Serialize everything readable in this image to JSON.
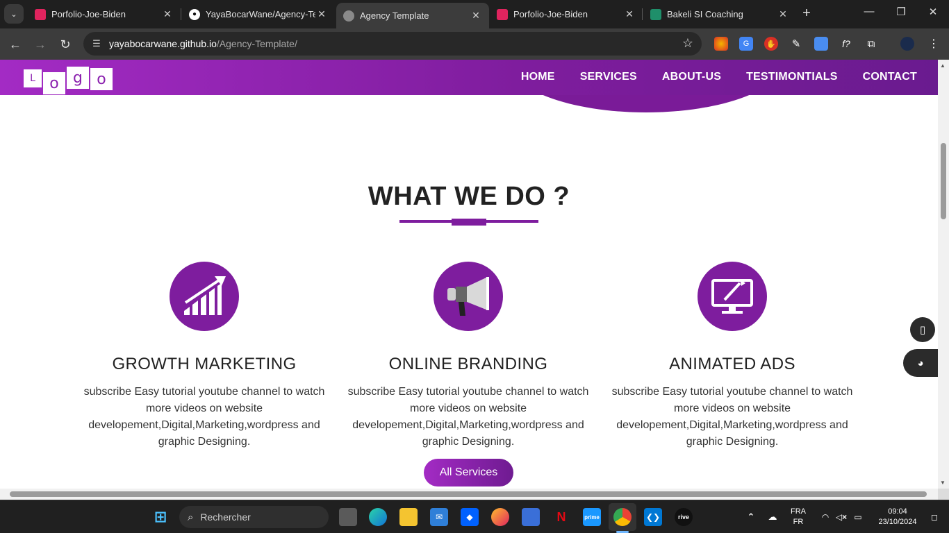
{
  "browser": {
    "tabs": [
      {
        "title": "Porfolio-Joe-Biden",
        "favicon": "red-square-icon"
      },
      {
        "title": "YayaBocarWane/Agency-Tem",
        "favicon": "github-icon"
      },
      {
        "title": "Agency Template",
        "favicon": "globe-icon",
        "active": true
      },
      {
        "title": "Porfolio-Joe-Biden",
        "favicon": "red-square-icon"
      },
      {
        "title": "Bakeli SI Coaching",
        "favicon": "bakeli-icon"
      }
    ],
    "url_host": "yayabocarwane.github.io",
    "url_path": "/Agency-Template/"
  },
  "site": {
    "logo_letters": [
      "L",
      "o",
      "g",
      "o"
    ],
    "nav": [
      "HOME",
      "SERVICES",
      "ABOUT-US",
      "TESTIMONTIALS",
      "CONTACT"
    ],
    "section_title": "WHAT WE DO ?",
    "services": [
      {
        "title": "GROWTH MARKETING",
        "icon": "growth-chart-icon",
        "text": "subscribe Easy tutorial youtube channel to watch more videos on website developement,Digital,Marketing,wordpress and graphic Designing."
      },
      {
        "title": "ONLINE BRANDING",
        "icon": "megaphone-icon",
        "text": "subscribe Easy tutorial youtube channel to watch more videos on website developement,Digital,Marketing,wordpress and graphic Designing."
      },
      {
        "title": "ANIMATED ADS",
        "icon": "monitor-pen-icon",
        "text": "subscribe Easy tutorial youtube channel to watch more videos on website developement,Digital,Marketing,wordpress and graphic Designing."
      }
    ],
    "cta_label": "All Services",
    "accent_color": "#7e1d9e"
  },
  "taskbar": {
    "search_placeholder": "Rechercher",
    "lang_top": "FRA",
    "lang_bottom": "FR",
    "time": "09:04",
    "date": "23/10/2024"
  }
}
